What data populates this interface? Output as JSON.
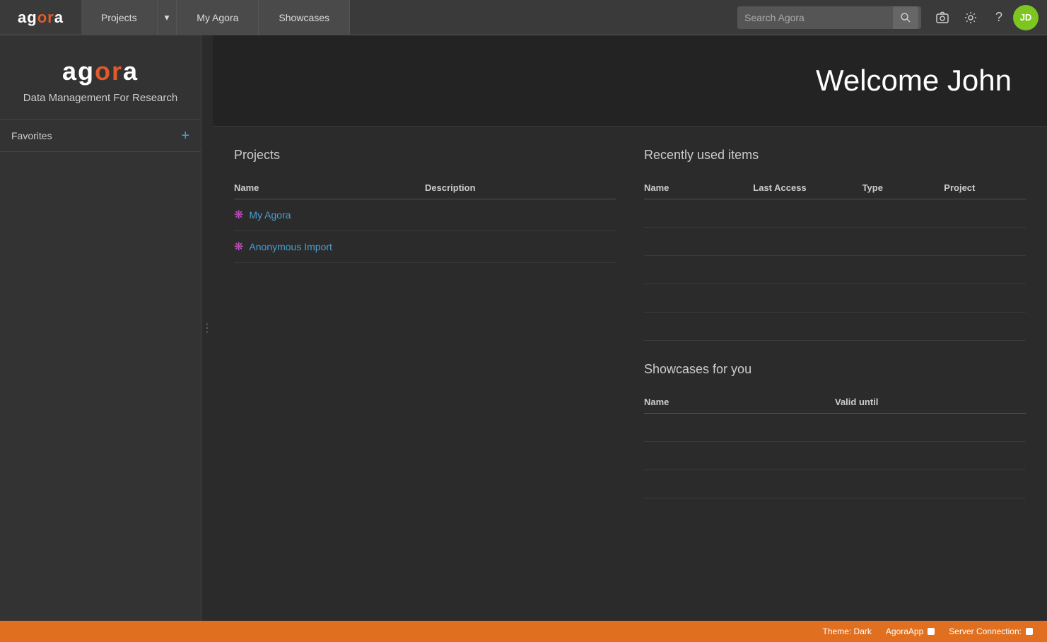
{
  "nav": {
    "logo": "agora",
    "logo_ag": "ag",
    "logo_or": "or",
    "logo_a": "a",
    "projects_label": "Projects",
    "myagora_label": "My Agora",
    "showcases_label": "Showcases",
    "search_placeholder": "Search Agora",
    "user_initials": "JD"
  },
  "sidebar": {
    "brand_ag": "ag",
    "brand_or": "or",
    "brand_a": "a",
    "subtitle": "Data Management For Research",
    "favorites_label": "Favorites",
    "add_label": "+"
  },
  "main": {
    "welcome_text": "Welcome John"
  },
  "projects": {
    "title": "Projects",
    "col_name": "Name",
    "col_description": "Description",
    "rows": [
      {
        "name": "My Agora",
        "description": ""
      },
      {
        "name": "Anonymous Import",
        "description": ""
      }
    ]
  },
  "recently_used": {
    "title": "Recently used items",
    "col_name": "Name",
    "col_last_access": "Last Access",
    "col_type": "Type",
    "col_project": "Project",
    "rows": []
  },
  "showcases": {
    "title": "Showcases for you",
    "col_name": "Name",
    "col_valid_until": "Valid until",
    "rows": []
  },
  "bottom_bar": {
    "theme_label": "Theme: Dark",
    "app_label": "AgoraApp",
    "server_label": "Server Connection:"
  }
}
